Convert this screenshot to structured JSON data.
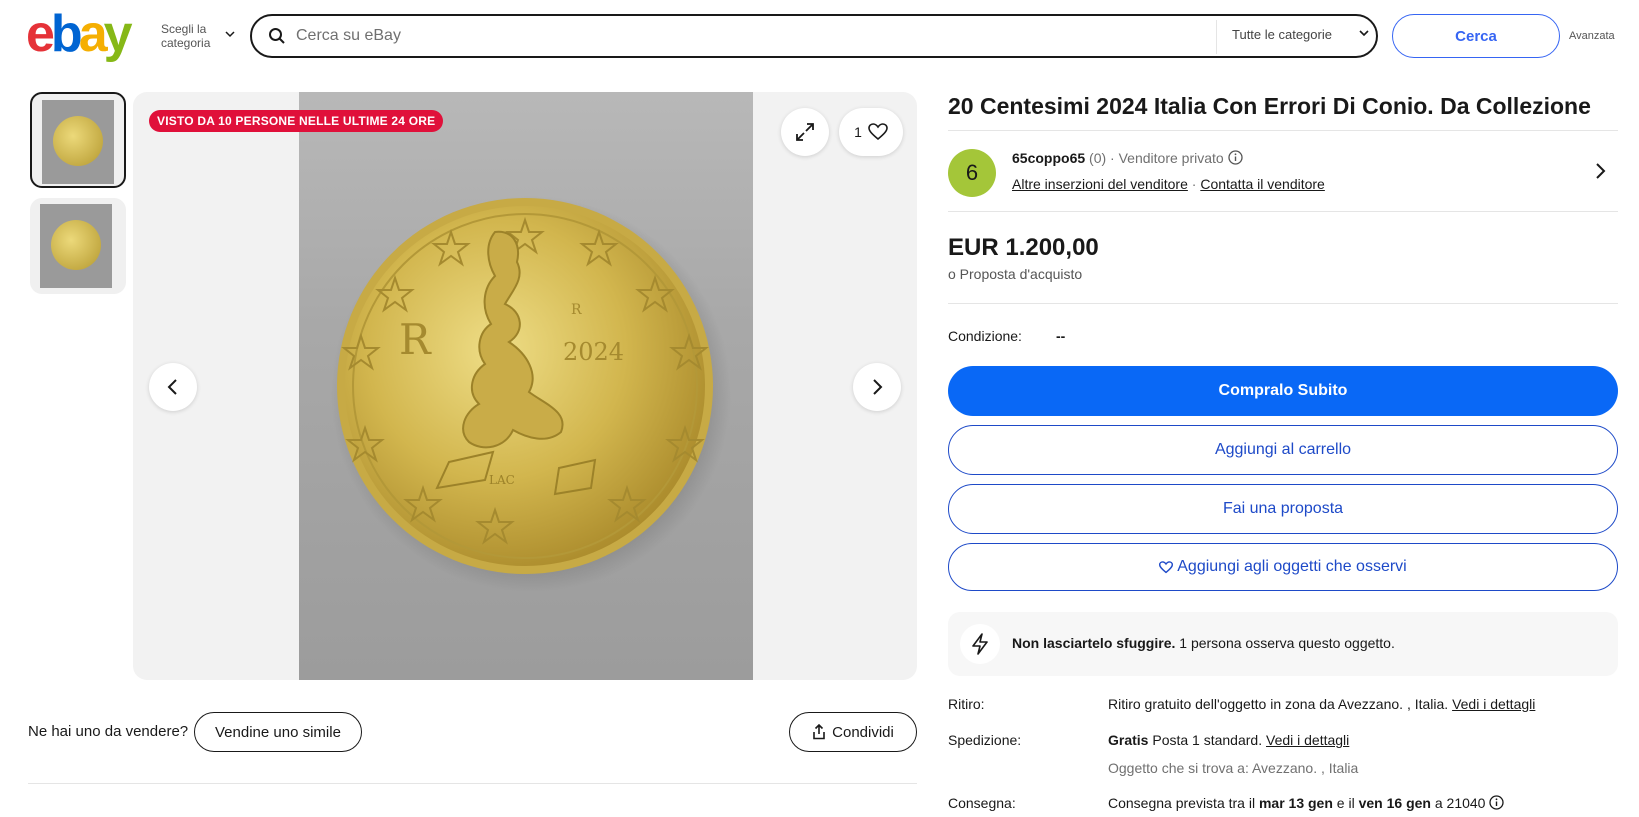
{
  "header": {
    "logo_letters": [
      "e",
      "b",
      "a",
      "y"
    ],
    "category_picker": "Scegli la categoria",
    "search_placeholder": "Cerca su eBay",
    "category_select": "Tutte le categorie",
    "search_button": "Cerca",
    "advanced_link": "Avanzata"
  },
  "gallery": {
    "views_badge": "VISTO DA 10 PERSONE NELLE ULTIME 24 ORE",
    "watch_count": "1",
    "sell_prompt": "Ne hai uno da vendere?",
    "sell_button": "Vendine uno simile",
    "share_button": "Condividi",
    "coin_year": "2024"
  },
  "listing": {
    "title": "20 Centesimi 2024 Italia Con Errori Di Conio. Da Collezione",
    "seller": {
      "avatar_letter": "6",
      "name": "65coppo65",
      "feedback": "(0)",
      "separator": "·",
      "type": "Venditore privato",
      "other_listings": "Altre inserzioni del venditore",
      "contact": "Contatta il venditore"
    },
    "price": "EUR 1.200,00",
    "price_sub": "o Proposta d'acquisto",
    "condition_label": "Condizione:",
    "condition_value": "--",
    "buttons": {
      "buy_now": "Compralo Subito",
      "add_to_cart": "Aggiungi al carrello",
      "make_offer": "Fai una proposta",
      "watch": "Aggiungi agli oggetti che osservi"
    },
    "urgency": {
      "bold": "Non lasciartelo sfuggire.",
      "rest": "1 persona osserva questo oggetto."
    },
    "pickup": {
      "label": "Ritiro:",
      "text": "Ritiro gratuito dell'oggetto in zona da Avezzano. , Italia.",
      "link": "Vedi i dettagli"
    },
    "shipping": {
      "label": "Spedizione:",
      "bold": "Gratis",
      "text": "Posta 1 standard.",
      "link": "Vedi i dettagli",
      "location": "Oggetto che si trova a: Avezzano. , Italia"
    },
    "delivery": {
      "label": "Consegna:",
      "prefix": "Consegna prevista tra il",
      "date1": "mar 13 gen",
      "middle": "e il",
      "date2": "ven 16 gen",
      "suffix": "a 21040"
    }
  },
  "colors": {
    "primary_blue": "#0968f6",
    "link_blue": "#1e4ac8",
    "badge_red": "#e0103a",
    "avatar_green": "#a4c639"
  }
}
